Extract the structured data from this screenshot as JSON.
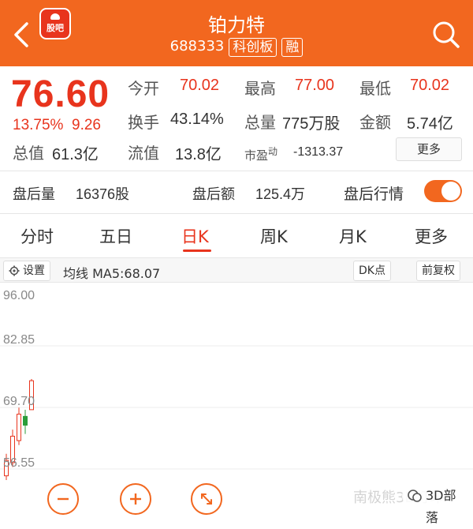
{
  "header": {
    "app_badge_label": "股吧",
    "stock_name": "铂力特",
    "stock_code": "688333",
    "tags": [
      "科创板",
      "融"
    ]
  },
  "quote": {
    "price": "76.60",
    "change_pct": "13.75%",
    "change_amt": "9.26",
    "open_label": "今开",
    "open_value": "70.02",
    "high_label": "最高",
    "high_value": "77.00",
    "low_label": "最低",
    "low_value": "70.02",
    "turnover_label": "换手",
    "turnover_value": "43.14%",
    "volume_label": "总量",
    "volume_value": "775万股",
    "amount_label": "金额",
    "amount_value": "5.74亿",
    "mktcap_label": "总值",
    "mktcap_value": "61.3亿",
    "float_label": "流值",
    "float_value": "13.8亿",
    "pe_label": "市盈",
    "pe_sup": "动",
    "pe_value": "-1313.37",
    "more_label": "更多"
  },
  "after_hours": {
    "volume_label": "盘后量",
    "volume_value": "16376股",
    "amount_label": "盘后额",
    "amount_value": "125.4万",
    "quote_label": "盘后行情",
    "toggle_on": true
  },
  "tabs": [
    {
      "label": "分时",
      "active": false
    },
    {
      "label": "五日",
      "active": false
    },
    {
      "label": "日K",
      "active": true
    },
    {
      "label": "周K",
      "active": false
    },
    {
      "label": "月K",
      "active": false
    },
    {
      "label": "更多",
      "active": false
    }
  ],
  "chart_toolbar": {
    "settings_label": "设置",
    "ma_text": "均线 MA5:68.07",
    "dk_label": "DK点",
    "adjust_label": "前复权"
  },
  "chart_data": {
    "type": "candlestick",
    "y_ticks": [
      "96.00",
      "82.85",
      "69.70",
      "56.55"
    ],
    "ylim": [
      56.55,
      96.0
    ],
    "candles": [
      {
        "open": 55.0,
        "close": 58.5,
        "high": 60.0,
        "low": 53.5,
        "color": "#e8341d"
      },
      {
        "open": 58.0,
        "close": 64.0,
        "high": 65.5,
        "low": 57.0,
        "color": "#e8341d"
      },
      {
        "open": 63.0,
        "close": 69.0,
        "high": 70.5,
        "low": 62.0,
        "color": "#e8341d"
      },
      {
        "open": 68.5,
        "close": 66.5,
        "high": 70.0,
        "low": 64.5,
        "color": "#2a9d3a"
      },
      {
        "open": 70.02,
        "close": 76.6,
        "high": 77.0,
        "low": 70.02,
        "color": "#e8341d"
      }
    ]
  },
  "watermark": {
    "text": "南极熊3D打印",
    "badge_text": "3D部落"
  },
  "colors": {
    "brand": "#f2671f",
    "up": "#e8341d",
    "down": "#2a9d3a"
  }
}
